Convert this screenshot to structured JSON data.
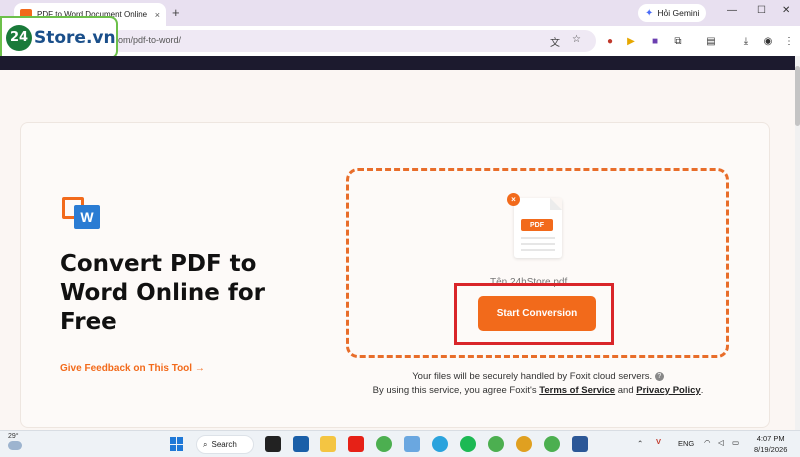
{
  "browser": {
    "tab_title": "PDF to Word Document Online",
    "tab_close": "×",
    "new_tab": "+",
    "url": "om/pdf-to-word/",
    "gemini_label": "Hỏi Gemini",
    "window_controls": [
      "—",
      "☐",
      "✕"
    ]
  },
  "watermark": {
    "number": "24",
    "text": "Store.vn"
  },
  "page": {
    "headline": "Convert PDF to Word Online for Free",
    "feedback_link": "Give Feedback on This Tool →",
    "pdf_badge": "PDF",
    "remove_file": "×",
    "filename": "Tên 24hStore.pdf",
    "start_button": "Start Conversion",
    "secure_note": "Your files will be securely handled by Foxit cloud servers.",
    "info_icon": "?",
    "terms_prefix": "By using this service, you agree Foxit's",
    "terms_link": "Terms of Service",
    "terms_and": "and",
    "privacy_link": "Privacy Policy",
    "terms_suffix": ".",
    "accent_color": "#f26a1b",
    "highlight_color": "#d9252a"
  },
  "taskbar": {
    "temperature": "29°",
    "search_label": "Search",
    "language": "ENG",
    "time": "4:07 PM",
    "date": "8/19/2026"
  }
}
